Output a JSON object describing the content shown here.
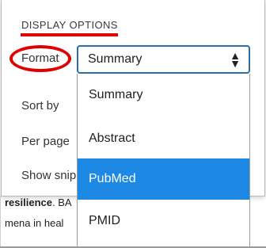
{
  "display_options": {
    "heading": "DISPLAY OPTIONS",
    "format_label": "Format",
    "format_selected": "Summary",
    "sort_label": "Sort by",
    "per_page_label": "Per page",
    "show_snippets_label": "Show snip",
    "format_options": [
      "Summary",
      "Abstract",
      "PubMed",
      "PMID"
    ],
    "highlighted_option": "PubMed"
  },
  "background_text": {
    "line1_bold": "resilience",
    "line1_rest": ". BA",
    "line2": "mena in heal"
  },
  "annotations": {
    "color": "#e00000"
  }
}
